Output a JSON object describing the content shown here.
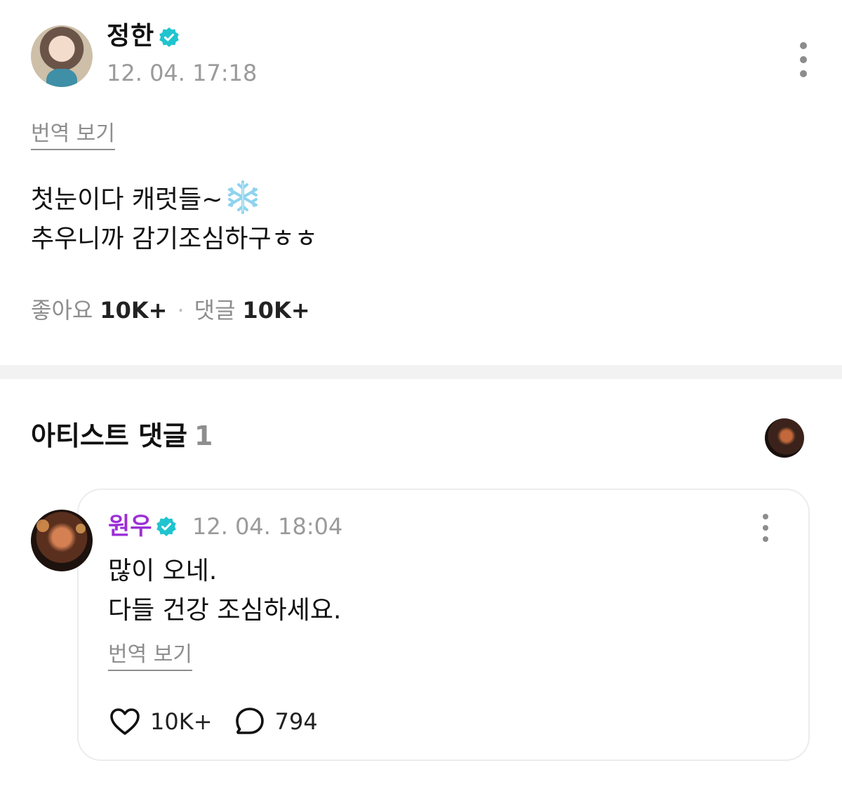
{
  "post": {
    "author": {
      "name": "정한",
      "verified_icon": "verified-badge-icon",
      "avatar_icon": "author-avatar"
    },
    "time": "12. 04. 17:18",
    "more_icon": "more-vertical-icon",
    "translate_label": "번역 보기",
    "body_lines": [
      "첫눈이다 캐럿들~",
      "추우니까 감기조심하구ㅎㅎ"
    ],
    "emoji": "snowflake-icon",
    "stats": {
      "likes_label": "좋아요",
      "likes_value": "10K+",
      "comments_label": "댓글",
      "comments_value": "10K+"
    }
  },
  "artist_comments": {
    "title": "아티스트 댓글",
    "count": "1",
    "comment": {
      "author": "원우",
      "verified_icon": "verified-badge-icon",
      "time": "12. 04. 18:04",
      "body_lines": [
        "많이 오네.",
        "다들 건강 조심하세요."
      ],
      "translate_label": "번역 보기",
      "likes": "10K+",
      "replies": "794"
    }
  },
  "colors": {
    "accent_badge": "#20c4cf",
    "commenter_name": "#9b2fd6",
    "muted_text": "#8e8e8e",
    "divider": "#f2f2f2"
  }
}
